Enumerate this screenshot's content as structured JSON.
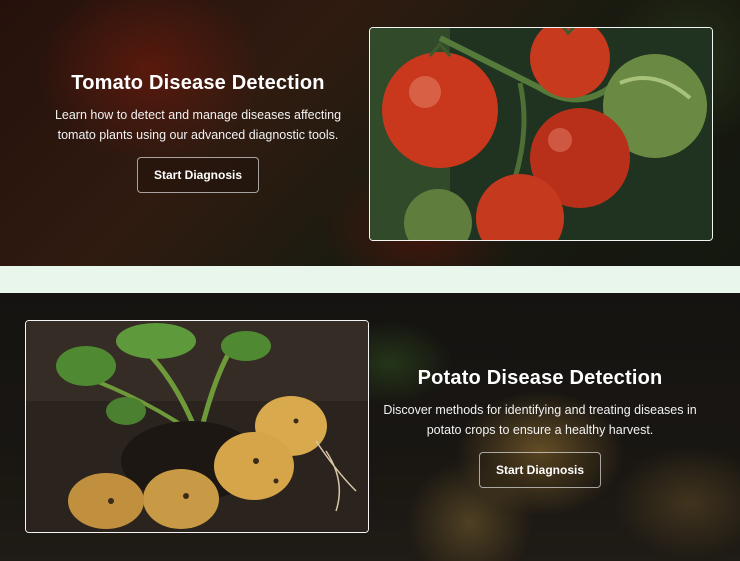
{
  "tomato_section": {
    "title": "Tomato Disease Detection",
    "description": "Learn how to detect and manage diseases affecting tomato plants using our advanced diagnostic tools.",
    "button_label": "Start Diagnosis"
  },
  "potato_section": {
    "title": "Potato Disease Detection",
    "description": "Discover methods for identifying and treating diseases in potato crops to ensure a healthy harvest.",
    "button_label": "Start Diagnosis"
  },
  "colors": {
    "separator_band": "#e9f6ec",
    "button_border": "#ffffff",
    "text": "#ffffff"
  }
}
